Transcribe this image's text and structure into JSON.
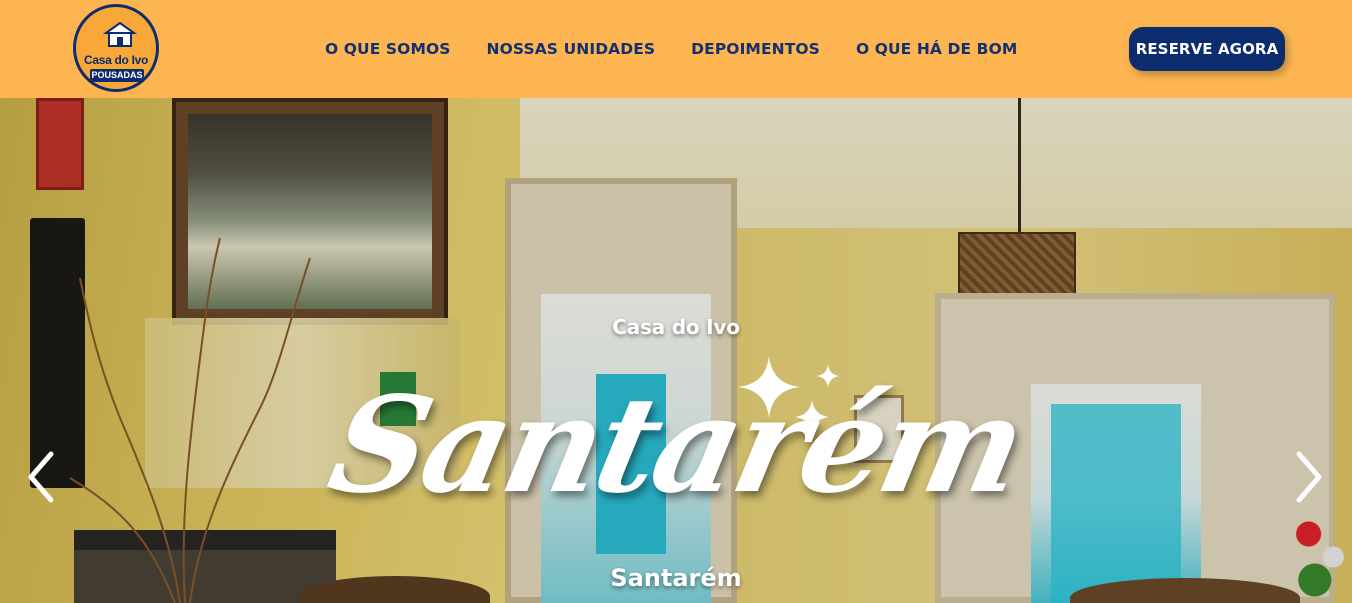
{
  "header": {
    "logo": {
      "line1": "Casa do Ivo",
      "line2": "POUSADAS"
    },
    "nav": [
      {
        "label": "O QUE SOMOS"
      },
      {
        "label": "NOSSAS UNIDADES"
      },
      {
        "label": "DEPOIMENTOS"
      },
      {
        "label": "O QUE HÁ DE BOM"
      }
    ],
    "cta_label": "RESERVE AGORA"
  },
  "hero": {
    "eyebrow": "Casa do Ivo",
    "script_title": "Santarém",
    "subtitle": "Santarém",
    "prev_icon": "chevron-left-icon",
    "next_icon": "chevron-right-icon"
  },
  "colors": {
    "header_bg": "#fdb552",
    "nav_text": "#13306f",
    "cta_bg": "#0c2c6e",
    "cta_text": "#ffffff"
  }
}
